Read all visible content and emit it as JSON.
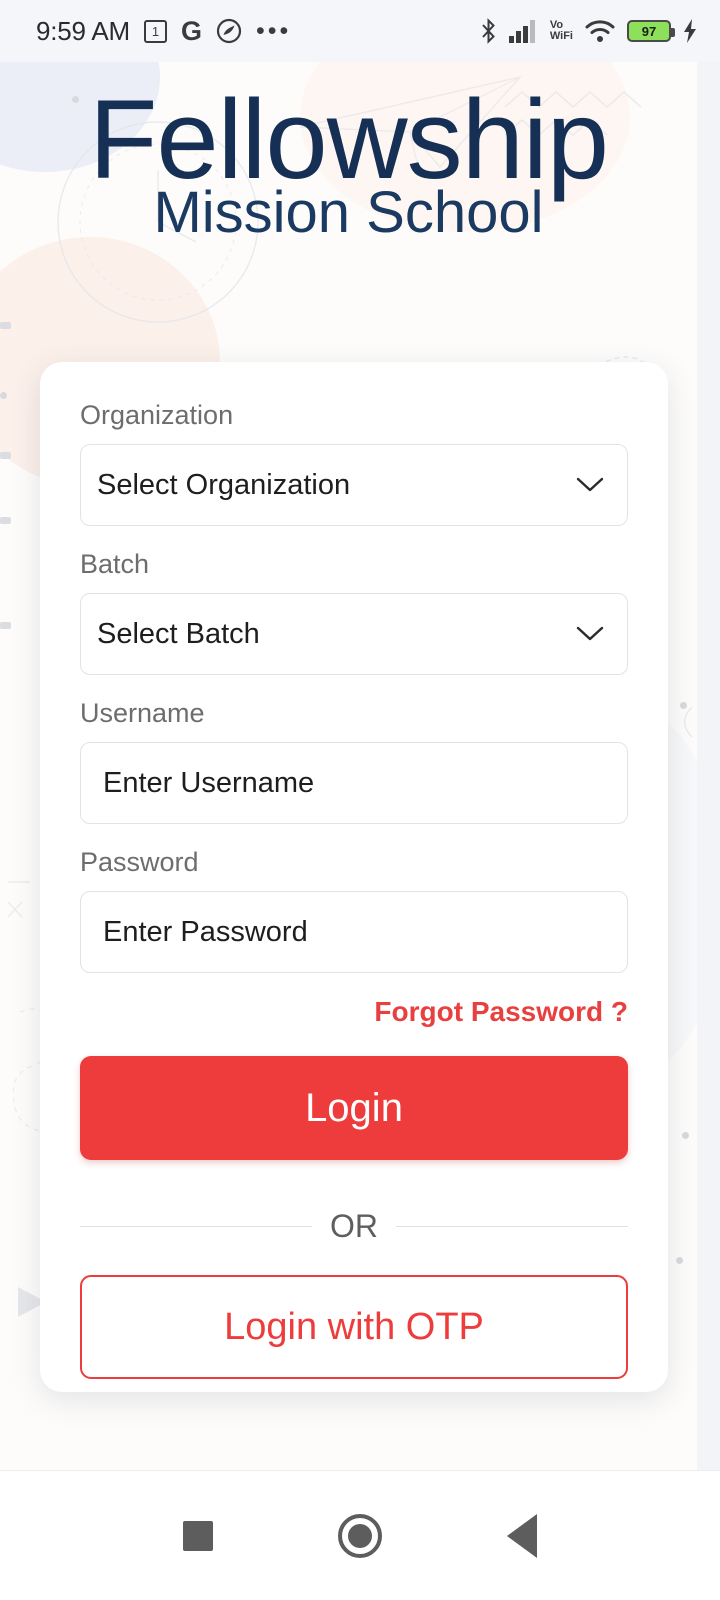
{
  "status_bar": {
    "time": "9:59 AM",
    "calendar_day": "1",
    "google_glyph": "G",
    "overflow_dots": "•••",
    "vo_line1": "Vo",
    "vo_line2": "WiFi",
    "battery_percent": "97",
    "icons": [
      "calendar-icon",
      "google-icon",
      "app-icon",
      "more-icon",
      "bluetooth-icon",
      "cellular-signal-icon",
      "vowifi-icon",
      "wifi-icon",
      "battery-icon",
      "charging-bolt-icon"
    ]
  },
  "logo": {
    "title": "Fellowship",
    "subtitle": "Mission School",
    "color": "#153054"
  },
  "form": {
    "organization": {
      "label": "Organization",
      "value": "Select Organization"
    },
    "batch": {
      "label": "Batch",
      "value": "Select Batch"
    },
    "username": {
      "label": "Username",
      "placeholder": "Enter Username"
    },
    "password": {
      "label": "Password",
      "placeholder": "Enter Password"
    },
    "forgot_password": "Forgot Password ?",
    "login_button": "Login",
    "divider_text": "OR",
    "otp_button": "Login with OTP"
  },
  "colors": {
    "accent_red": "#ee3b3b",
    "logo_navy": "#153054",
    "label_gray": "#6d6d6d",
    "card_bg": "#ffffff",
    "page_bg": "#fdfcfb"
  },
  "nav_bar": {
    "recents": "recents-square",
    "home": "home-circle",
    "back": "back-triangle"
  }
}
